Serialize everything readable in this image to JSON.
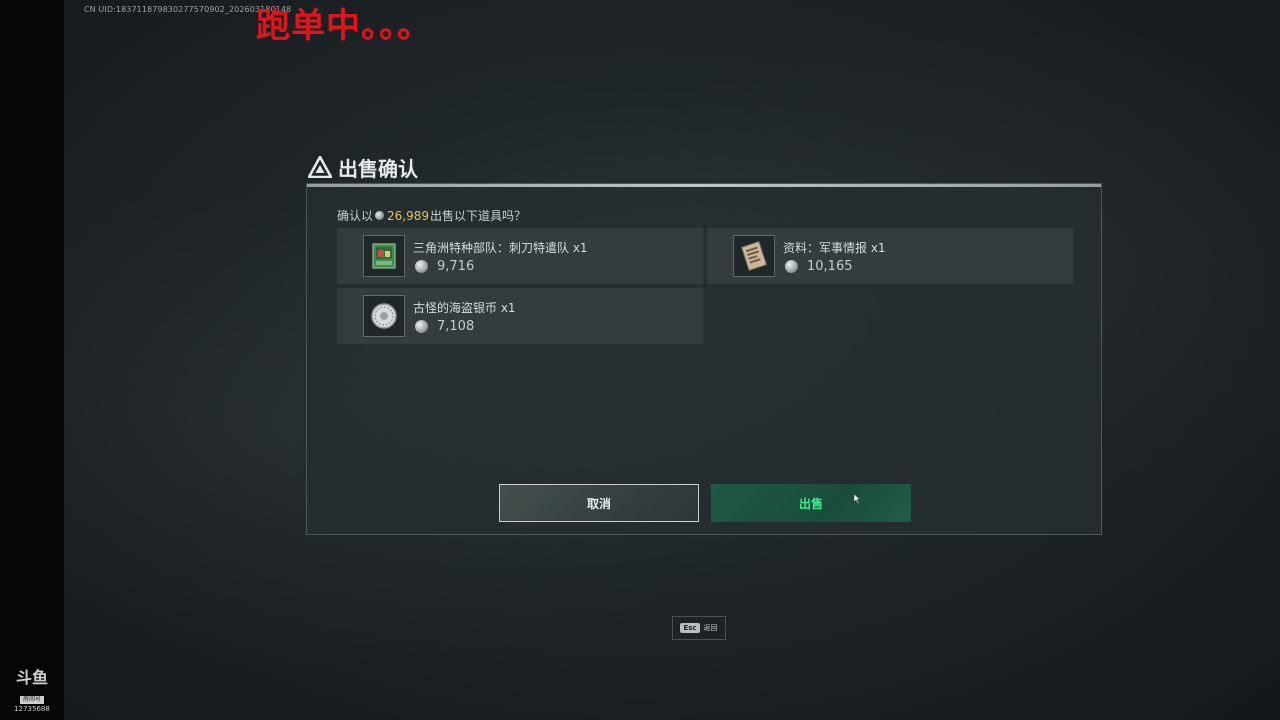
{
  "hud": {
    "uid": "CN UID:183711879830277570902_202603180148",
    "overlay": "跑单中。。。"
  },
  "logo": {
    "mark": "斗鱼",
    "sub": "房间号",
    "room": "12735688"
  },
  "dialog": {
    "title": "出售确认",
    "confirm_prefix": "确认以",
    "total": "26,989",
    "confirm_suffix": "出售以下道具吗？",
    "items": [
      {
        "name": "三角洲特种部队：刺刀特遣队 x1",
        "price": "9,716",
        "icon": "art-card-icon"
      },
      {
        "name": "资料：军事情报 x1",
        "price": "10,165",
        "icon": "intel-document-icon"
      },
      {
        "name": "古怪的海盗银币 x1",
        "price": "7,108",
        "icon": "silver-coin-icon"
      }
    ],
    "cancel_label": "取消",
    "sell_label": "出售"
  },
  "esc": {
    "key": "Esc",
    "label": "返回"
  }
}
